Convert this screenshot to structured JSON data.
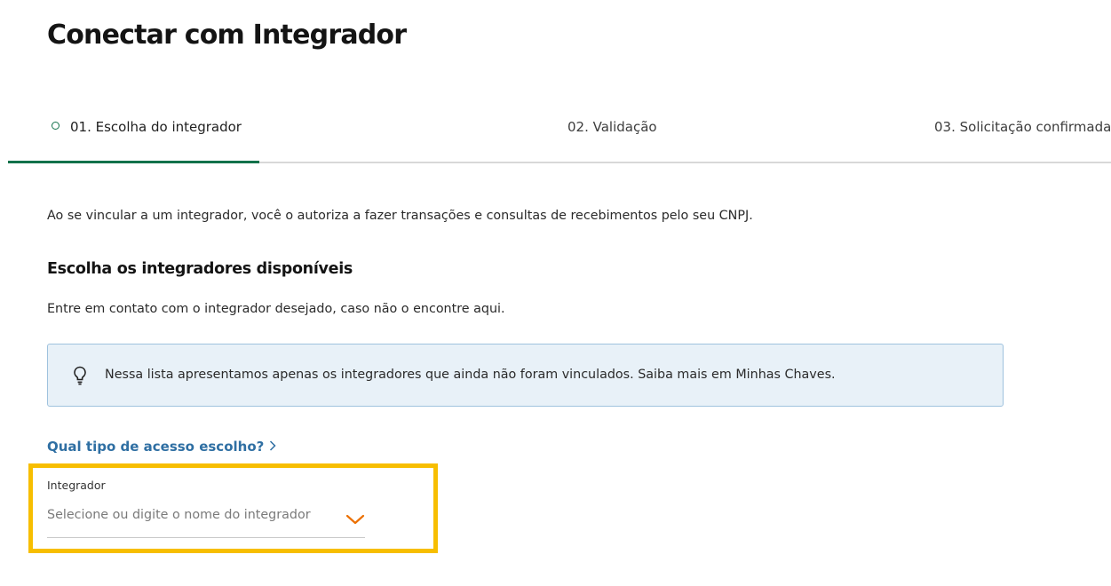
{
  "page": {
    "title": "Conectar com Integrador"
  },
  "stepper": {
    "steps": [
      {
        "label": "01. Escolha do integrador",
        "state": "active"
      },
      {
        "label": "02. Validação",
        "state": "pending"
      },
      {
        "label": "03. Solicitação confirmada",
        "state": "pending"
      }
    ]
  },
  "intro": {
    "text": "Ao se vincular a um integrador, você o autoriza a fazer transações e consultas de recebimentos pelo seu CNPJ."
  },
  "section": {
    "title": "Escolha os integradores disponíveis",
    "subtitle": "Entre em contato com o integrador desejado, caso não o encontre aqui."
  },
  "info": {
    "icon": "lightbulb-icon",
    "text": "Nessa lista apresentamos apenas os integradores que ainda não foram vinculados. Saiba mais em Minhas Chaves."
  },
  "access_link": {
    "label": "Qual tipo de acesso escolho?",
    "icon": "chevron-right-icon"
  },
  "integrator_field": {
    "label": "Integrador",
    "placeholder": "Selecione ou digite o nome do integrador",
    "icon": "chevron-down-icon"
  },
  "colors": {
    "accent_green": "#11714a",
    "link_blue": "#2f6fa3",
    "info_bg": "#e8f1f8",
    "info_border": "#9fc2de",
    "highlight_yellow": "#f7be00",
    "chevron_orange": "#ec7000"
  }
}
